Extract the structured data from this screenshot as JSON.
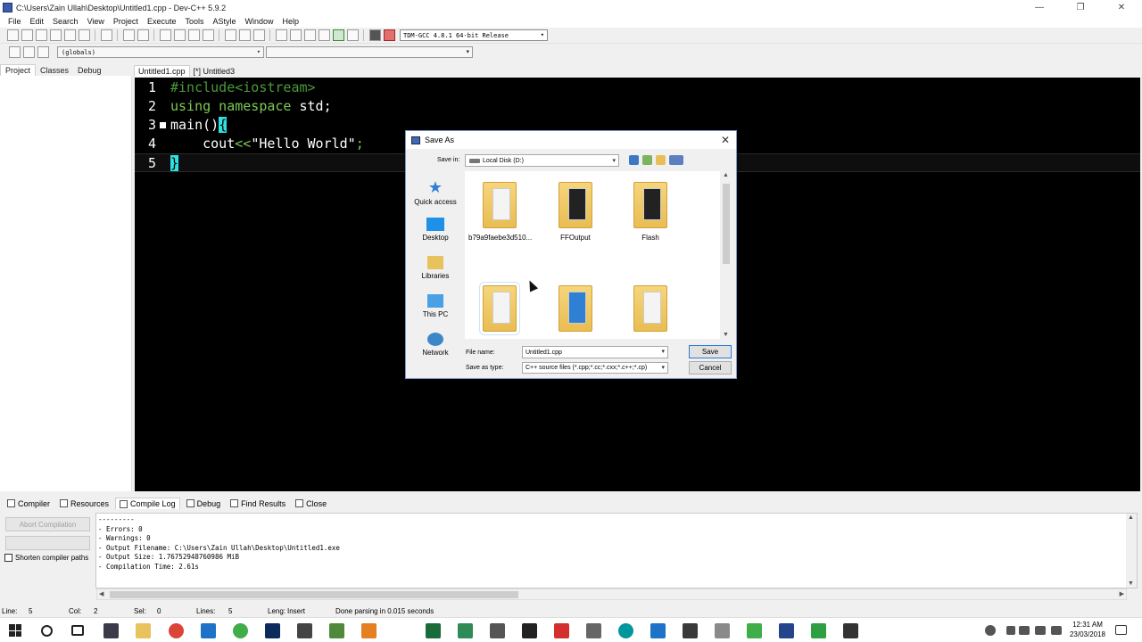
{
  "window": {
    "title": "C:\\Users\\Zain Ullah\\Desktop\\Untitled1.cpp - Dev-C++ 5.9.2",
    "controls": [
      "—",
      "❐",
      "✕"
    ]
  },
  "menu": [
    "File",
    "Edit",
    "Search",
    "View",
    "Project",
    "Execute",
    "Tools",
    "AStyle",
    "Window",
    "Help"
  ],
  "toolbar": {
    "compiler": "TDM-GCC 4.8.1 64-bit Release",
    "scope": "(globals)"
  },
  "left_tabs": [
    "Project",
    "Classes",
    "Debug"
  ],
  "editor_tabs": [
    "Untitled1.cpp",
    "[*] Untitled3"
  ],
  "code": {
    "line1": {
      "num": "1",
      "pre": "#include<iostream>"
    },
    "line2": {
      "num": "2",
      "kw": "using namespace",
      "rest": " std;"
    },
    "line3": {
      "num": "3",
      "fn": "main()",
      "brace": "{"
    },
    "line4": {
      "num": "4",
      "indent": "    ",
      "cout": "cout",
      "op": "<<",
      "str": "\"Hello World\"",
      "end": ";"
    },
    "line5": {
      "num": "5",
      "brace": "}"
    }
  },
  "dialog": {
    "title": "Save As",
    "save_in_label": "Save in:",
    "save_in_value": "Local Disk (D:)",
    "places": [
      "Quick access",
      "Desktop",
      "Libraries",
      "This PC",
      "Network"
    ],
    "folders": [
      "b79a9faebe3d510...",
      "FFOutput",
      "Flash",
      "",
      "",
      ""
    ],
    "file_name_label": "File name:",
    "file_name": "Untitled1.cpp",
    "save_as_type_label": "Save as type:",
    "save_as_type": "C++ source files (*.cpp;*.cc;*.cxx;*.c++;*.cp)",
    "save_button": "Save",
    "cancel_button": "Cancel"
  },
  "bottom_tabs": [
    "Compiler",
    "Resources",
    "Compile Log",
    "Debug",
    "Find Results",
    "Close"
  ],
  "abort_button": "Abort Compilation",
  "shorten_label": "Shorten compiler paths",
  "log": [
    "---------",
    "- Errors: 0",
    "- Warnings: 0",
    "- Output Filename: C:\\Users\\Zain Ullah\\Desktop\\Untitled1.exe",
    "- Output Size: 1.76752948760986 MiB",
    "- Compilation Time: 2.61s"
  ],
  "status": {
    "line_label": "Line:",
    "line": "5",
    "col_label": "Col:",
    "col": "2",
    "sel_label": "Sel:",
    "sel": "0",
    "lines_label": "Lines:",
    "lines": "5",
    "leng_label": "Leng:",
    "mode": "Insert",
    "message": "Done parsing in 0.015 seconds"
  },
  "taskbar": {
    "time": "12:31 AM",
    "date": "23/03/2018"
  },
  "colors": {
    "editor_bg": "#000000",
    "preprocessor": "#4c9a3c",
    "keyword": "#7ec954",
    "bracket_highlight": "#2ee0e0"
  }
}
